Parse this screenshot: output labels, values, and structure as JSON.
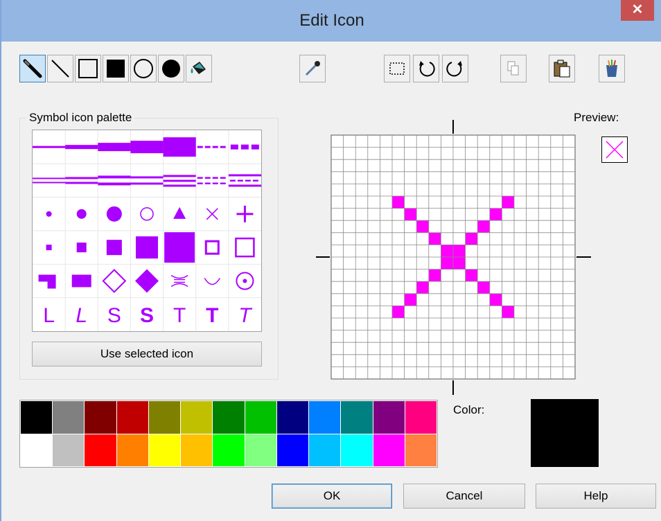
{
  "window": {
    "title": "Edit Icon",
    "close_glyph": "✕"
  },
  "toolbar": {
    "tools": [
      {
        "name": "pencil-tool",
        "icon": "pencil-icon",
        "selected": true
      },
      {
        "name": "line-tool",
        "icon": "line-icon"
      },
      {
        "name": "rectangle-tool",
        "icon": "rectangle-outline-icon"
      },
      {
        "name": "filled-rectangle-tool",
        "icon": "rectangle-filled-icon"
      },
      {
        "name": "ellipse-tool",
        "icon": "ellipse-outline-icon"
      },
      {
        "name": "filled-ellipse-tool",
        "icon": "ellipse-filled-icon"
      },
      {
        "name": "fill-tool",
        "icon": "paint-bucket-icon"
      },
      {
        "name": "eyedropper-tool",
        "icon": "eyedropper-icon"
      }
    ],
    "actions": [
      {
        "name": "select-button",
        "icon": "marquee-select-icon"
      },
      {
        "name": "rotate-left-button",
        "icon": "rotate-ccw-icon"
      },
      {
        "name": "rotate-right-button",
        "icon": "rotate-cw-icon"
      },
      {
        "name": "copy-button",
        "icon": "copy-icon",
        "disabled": true
      },
      {
        "name": "paste-button",
        "icon": "paste-icon"
      },
      {
        "name": "clear-button",
        "icon": "brush-cup-icon"
      }
    ]
  },
  "palette": {
    "label": "Symbol icon palette",
    "button": "Use selected icon",
    "accent": "#aa00ff",
    "rows": [
      [
        "line-thin",
        "line-medium",
        "line-thick",
        "line-thicker",
        "line-thickest",
        "dash-thin",
        "dash-thick"
      ],
      [
        "double-thin",
        "double-medium",
        "double-thick",
        "double-split",
        "triple",
        "double-dash",
        "triple-dash"
      ],
      [
        "dot-small",
        "dot-medium",
        "dot-large",
        "circle-outline",
        "triangle",
        "x-mark",
        "plus"
      ],
      [
        "square-tiny",
        "square-small",
        "square-medium",
        "square-large",
        "square-xl",
        "square-outline-small",
        "square-outline-large"
      ],
      [
        "step-shape",
        "rect-wide",
        "diamond-outline",
        "diamond-filled",
        "bowtie",
        "arc",
        "circle-dot"
      ],
      [
        "glyph-L",
        "glyph-L-italic",
        "glyph-S",
        "glyph-S-bold",
        "glyph-T",
        "glyph-T-bold",
        "glyph-T-italic"
      ]
    ],
    "glyph_text": {
      "glyph-L": "L",
      "glyph-L-italic": "L",
      "glyph-S": "S",
      "glyph-S-bold": "S",
      "glyph-T": "T",
      "glyph-T-bold": "T",
      "glyph-T-italic": "T"
    }
  },
  "editor": {
    "grid_size": 20,
    "pixel_color": "#ff00ff",
    "pixels": [
      [
        5,
        5
      ],
      [
        14,
        5
      ],
      [
        6,
        6
      ],
      [
        13,
        6
      ],
      [
        7,
        7
      ],
      [
        12,
        7
      ],
      [
        8,
        8
      ],
      [
        11,
        8
      ],
      [
        9,
        9
      ],
      [
        10,
        9
      ],
      [
        9,
        10
      ],
      [
        10,
        10
      ],
      [
        8,
        11
      ],
      [
        11,
        11
      ],
      [
        7,
        12
      ],
      [
        12,
        12
      ],
      [
        6,
        13
      ],
      [
        13,
        13
      ],
      [
        5,
        14
      ],
      [
        14,
        14
      ]
    ]
  },
  "preview": {
    "label": "Preview:",
    "glyph_color": "#ff00ff"
  },
  "colors": {
    "top": [
      "#000000",
      "#808080",
      "#800000",
      "#c00000",
      "#808000",
      "#c0c000",
      "#008000",
      "#00c000",
      "#000080",
      "#0080ff",
      "#008080",
      "#800080",
      "#ff0080"
    ],
    "bottom": [
      "#ffffff",
      "#c0c0c0",
      "#ff0000",
      "#ff8000",
      "#ffff00",
      "#ffc000",
      "#00ff00",
      "#80ff80",
      "#0000ff",
      "#00c0ff",
      "#00ffff",
      "#ff00ff",
      "#ff8040"
    ]
  },
  "color": {
    "label": "Color:",
    "current": "#000000"
  },
  "buttons": {
    "ok": "OK",
    "cancel": "Cancel",
    "help": "Help"
  }
}
